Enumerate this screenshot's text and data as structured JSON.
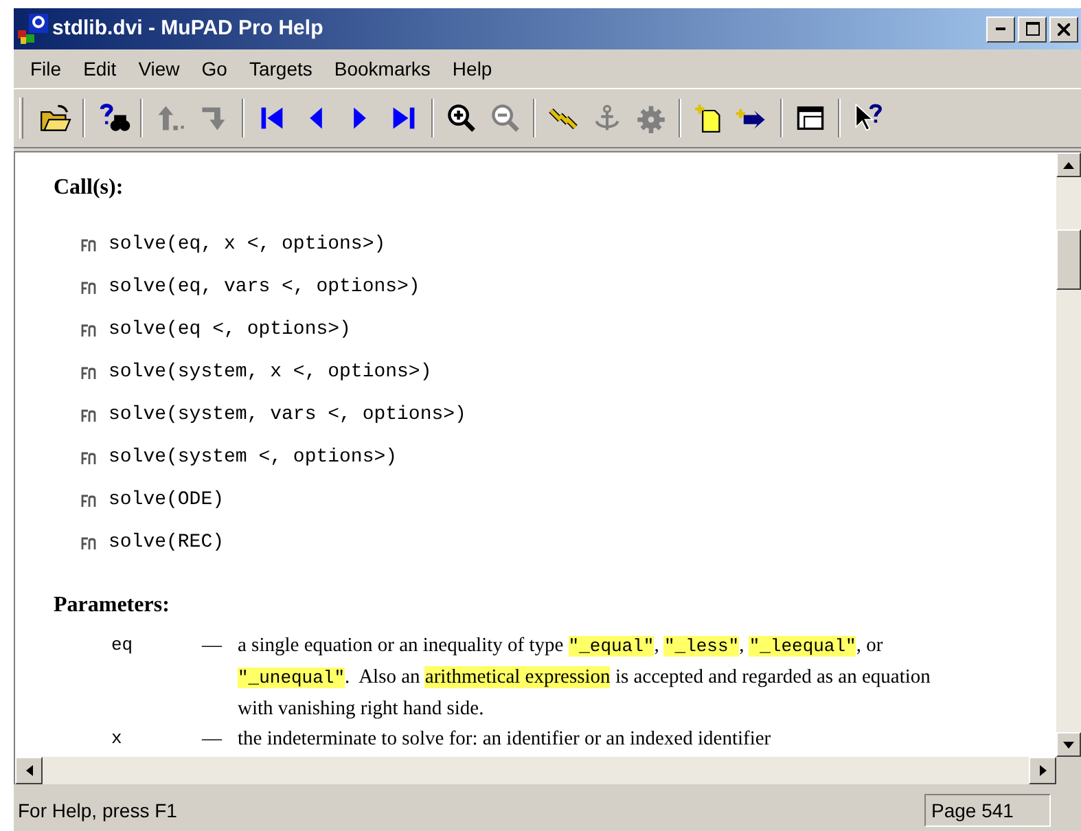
{
  "window": {
    "title": "stdlib.dvi - MuPAD Pro Help"
  },
  "menu": [
    "File",
    "Edit",
    "View",
    "Go",
    "Targets",
    "Bookmarks",
    "Help"
  ],
  "toolbar": [
    {
      "kind": "open",
      "disabled": false
    },
    {
      "kind": "separator"
    },
    {
      "kind": "find",
      "disabled": false
    },
    {
      "kind": "separator"
    },
    {
      "kind": "back",
      "disabled": true
    },
    {
      "kind": "forward",
      "disabled": true
    },
    {
      "kind": "separator"
    },
    {
      "kind": "first",
      "disabled": false
    },
    {
      "kind": "prev",
      "disabled": false
    },
    {
      "kind": "next",
      "disabled": false
    },
    {
      "kind": "last",
      "disabled": false
    },
    {
      "kind": "separator"
    },
    {
      "kind": "zoomin",
      "disabled": false
    },
    {
      "kind": "zoomout",
      "disabled": true
    },
    {
      "kind": "separator"
    },
    {
      "kind": "link",
      "disabled": false
    },
    {
      "kind": "anchor",
      "disabled": true
    },
    {
      "kind": "gear",
      "disabled": true
    },
    {
      "kind": "separator"
    },
    {
      "kind": "note",
      "disabled": false
    },
    {
      "kind": "notejump",
      "disabled": false
    },
    {
      "kind": "separator"
    },
    {
      "kind": "window",
      "disabled": false
    },
    {
      "kind": "separator"
    },
    {
      "kind": "help",
      "disabled": false
    }
  ],
  "calls_section": {
    "heading": "Call(s):",
    "calls": [
      "solve(eq, x <, options>)",
      "solve(eq, vars <, options>)",
      "solve(eq <, options>)",
      "solve(system, x <, options>)",
      "solve(system, vars <, options>)",
      "solve(system <, options>)",
      "solve(ODE)",
      "solve(REC)"
    ]
  },
  "parameters_section": {
    "heading": "Parameters:",
    "params": [
      {
        "name": "eq",
        "dash": "—",
        "description": [
          {
            "text": "a single equation or an inequality of type ",
            "kind": "text",
            "highlighted": false
          },
          {
            "text": "\"_equal\"",
            "kind": "code",
            "highlighted": true
          },
          {
            "text": ", ",
            "kind": "text",
            "highlighted": false
          },
          {
            "text": "\"_less\"",
            "kind": "code",
            "highlighted": true
          },
          {
            "text": ", ",
            "kind": "text",
            "highlighted": false
          },
          {
            "text": "\"_leequal\"",
            "kind": "code",
            "highlighted": true
          },
          {
            "text": ", or ",
            "kind": "text",
            "highlighted": false
          },
          {
            "text": "\"_unequal\"",
            "kind": "code",
            "highlighted": true
          },
          {
            "text": ".  Also an ",
            "kind": "text",
            "highlighted": false
          },
          {
            "text": "arithmetical expression",
            "kind": "text",
            "highlighted": true
          },
          {
            "text": " is accepted and regarded as an equation with vanishing right hand side.",
            "kind": "text",
            "highlighted": false
          }
        ]
      },
      {
        "name": "x",
        "dash": "—",
        "description": [
          {
            "text": "the indeterminate to solve for: an identifier or an indexed identifier",
            "kind": "text",
            "highlighted": false
          }
        ]
      }
    ]
  },
  "status_bar": {
    "message": "For Help, press F1",
    "page": "Page 541"
  }
}
